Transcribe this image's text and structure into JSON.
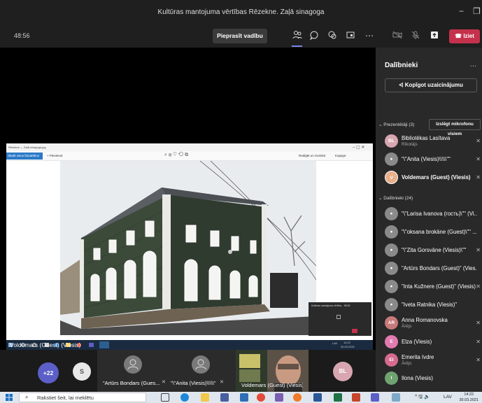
{
  "window": {
    "title": "Kultūras mantojuma vērtības Rēzekne. Zaļā sinagoga",
    "minimize": "−",
    "restore": "❐"
  },
  "toolbar": {
    "timer": "48:56",
    "request_control": "Pieprasīt vadību",
    "leave": "Iziet"
  },
  "shared_screen": {
    "file_title": "Rēzekne — Zaļā sinagoga.jpg",
    "edit_label": "Skatīt visus fotoattēlus",
    "add_label": "+ Pievienot",
    "share_label": "Rediģēt un izveidot",
    "copy_label": "Kopīgot",
    "mini_call_title": "Kultūras mantojuma vērtība... 58:35",
    "taskbar_lang": "LAV",
    "taskbar_time": "14:22",
    "taskbar_date": "30.03.2021"
  },
  "speaker": "Voldemars (Guest) (Viesis)",
  "gallery": {
    "overflow_count": "+22",
    "tiles": [
      {
        "initial": "S"
      },
      {
        "name": "\"Artūrs Bondars (Gues..."
      },
      {
        "name": "\"\\\"Anita (Viesis)\\\\\\\\\\\""
      },
      {
        "name": "Voldemars (Guest) (Viesis)"
      },
      {
        "initial": "BL"
      }
    ]
  },
  "participants_panel": {
    "title": "Dalībnieki",
    "more": "...",
    "copy_invite": "Kopīgot uzaicinājumu",
    "presenters_header": "Prezentētāji (3)",
    "mute_all": "Izslēgt mikrofonu visiem",
    "presenters": [
      {
        "initials": "BL",
        "name": "Bibliotēkas Lasītava",
        "role": "Rīkotājs"
      },
      {
        "initials": "",
        "name": "\"\\\"Anita (Viesis)\\\\\\\\\\\"\""
      },
      {
        "initials": "V",
        "name": "Voldemars (Guest) (Viesis)"
      }
    ],
    "attendees_header": "Dalībnieki (24)",
    "attendees": [
      {
        "initials": "",
        "name": "\"\\\"Larisa Ivanova (гость)\\\"\" (Vi..."
      },
      {
        "initials": "",
        "name": "\"\\\"oksana brokāne (Guest)\\\"\" ..."
      },
      {
        "initials": "",
        "name": "\"\\\"Zita Gorsvāne (Viesis)\\\"\""
      },
      {
        "initials": "",
        "name": "\"Artūrs Bondars (Guest)\" (Vies..."
      },
      {
        "initials": "",
        "name": "\"Inta Kužnere (Guest)\" (Viesis)"
      },
      {
        "initials": "",
        "name": "\"Iveta Ratnika (Viesis)\""
      },
      {
        "initials": "AR",
        "name": "Anna Romanovska",
        "role": "Ārējs"
      },
      {
        "initials": "E",
        "name": "Elza (Viesis)"
      },
      {
        "initials": "EI",
        "name": "Emerita Ivdre",
        "role": "Ārējs"
      },
      {
        "initials": "I",
        "name": "Ilona (Viesis)"
      }
    ]
  },
  "taskbar": {
    "search_placeholder": "Rakstiet šeit, lai meklētu",
    "lang": "LAV",
    "time": "14:22",
    "date": "30.03.2021"
  },
  "colors": {
    "accent": "#7b83eb",
    "leave": "#c4314b",
    "panel": "#292929",
    "bar": "#1f1f1f"
  }
}
